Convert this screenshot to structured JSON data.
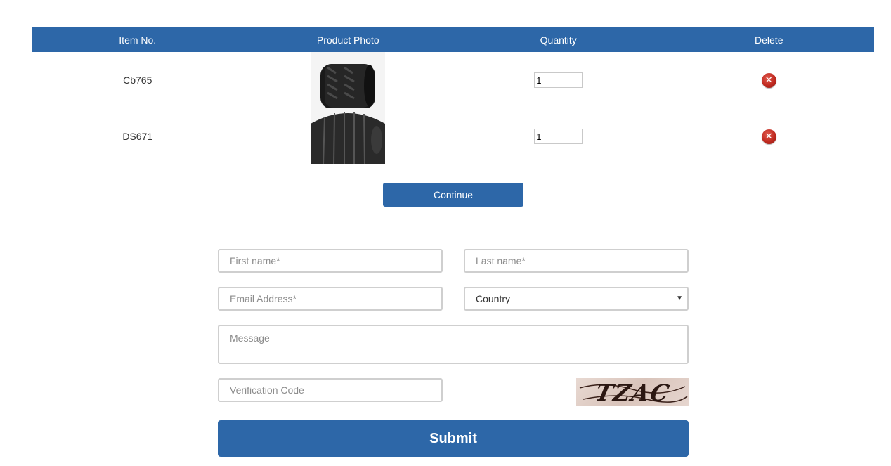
{
  "cart": {
    "headers": [
      "Item No.",
      "Product Photo",
      "Quantity",
      "Delete"
    ],
    "rows": [
      {
        "item_no": "Cb765",
        "quantity": "1"
      },
      {
        "item_no": "DS671",
        "quantity": "1"
      }
    ]
  },
  "continue_label": "Continue",
  "form": {
    "first_name_placeholder": "First name*",
    "last_name_placeholder": "Last name*",
    "email_placeholder": "Email Address*",
    "country_selected": "Country",
    "message_placeholder": "Message",
    "verification_placeholder": "Verification Code",
    "captcha_text": "TZAC",
    "submit_label": "Submit"
  },
  "colors": {
    "accent": "#2d67a8",
    "delete_icon": "#c02a20"
  },
  "icons": {
    "delete": "close-circle-icon",
    "dropdown": "chevron-down-icon"
  }
}
